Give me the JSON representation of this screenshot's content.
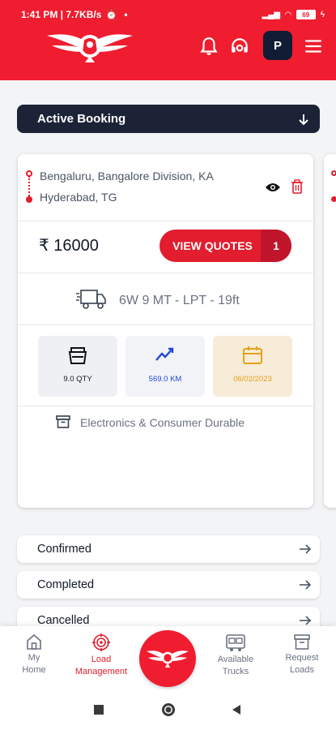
{
  "status_bar": {
    "time_speed": "1:41 PM | 7.7KB/s",
    "battery": "69"
  },
  "header": {
    "avatar_initial": "P"
  },
  "active_booking": {
    "label": "Active Booking"
  },
  "booking": {
    "from": "Bengaluru, Bangalore Division, KA",
    "to": "Hyderabad, TG",
    "price": "₹ 16000",
    "view_quotes_label": "VIEW QUOTES",
    "quotes_count": "1",
    "truck_type": "6W 9 MT - LPT - 19ft",
    "stats": {
      "quantity": "9.0 QTY",
      "distance": "569.0 KM",
      "date": "06/02/2023"
    },
    "goods_type": "Electronics & Consumer Durable"
  },
  "status_list": [
    {
      "label": "Confirmed"
    },
    {
      "label": "Completed"
    },
    {
      "label": "Cancelled"
    }
  ],
  "bottom_nav": {
    "home": {
      "line1": "My",
      "line2": "Home"
    },
    "load": {
      "line1": "Load",
      "line2": "Management"
    },
    "trucks": {
      "line1": "Available",
      "line2": "Trucks"
    },
    "request": {
      "line1": "Request",
      "line2": "Loads"
    }
  },
  "colors": {
    "brand_red": "#ef1d2f",
    "navy": "#1c2337",
    "distance_blue": "#2347d6",
    "date_orange": "#e5a21a"
  }
}
